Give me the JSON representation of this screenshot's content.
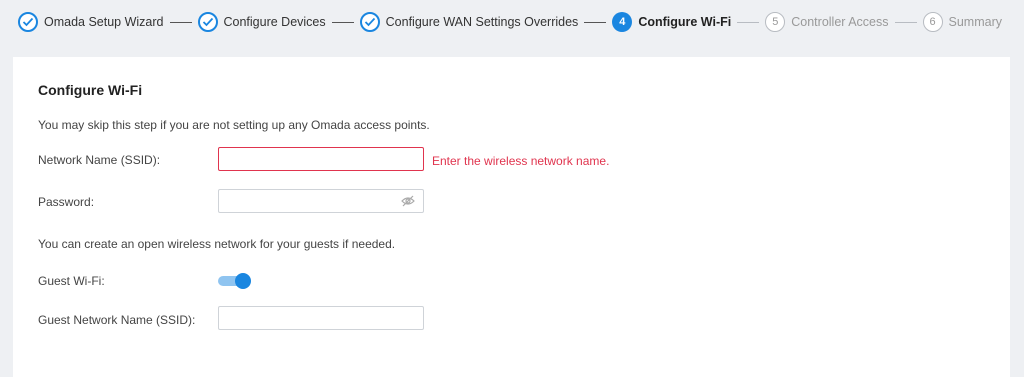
{
  "stepper": {
    "steps": [
      {
        "number": "1",
        "label": "Omada Setup Wizard",
        "state": "done"
      },
      {
        "number": "2",
        "label": "Configure Devices",
        "state": "done"
      },
      {
        "number": "3",
        "label": "Configure WAN Settings Overrides",
        "state": "done"
      },
      {
        "number": "4",
        "label": "Configure Wi-Fi",
        "state": "active"
      },
      {
        "number": "5",
        "label": "Controller Access",
        "state": "pending"
      },
      {
        "number": "6",
        "label": "Summary",
        "state": "pending"
      }
    ]
  },
  "card": {
    "title": "Configure Wi-Fi",
    "skip_note": "You may skip this step if you are not setting up any Omada access points.",
    "ssid": {
      "label": "Network Name (SSID):",
      "value": "",
      "error": "Enter the wireless network name."
    },
    "password": {
      "label": "Password:",
      "value": "",
      "icon": "eye-hidden-icon"
    },
    "guest_note": "You can create an open wireless network for your guests if needed.",
    "guest_wifi": {
      "label": "Guest Wi-Fi:",
      "enabled": true
    },
    "guest_ssid": {
      "label": "Guest Network Name (SSID):",
      "value": ""
    }
  },
  "colors": {
    "accent": "#1a86e0",
    "error": "#e0344e",
    "pending": "#999999"
  }
}
